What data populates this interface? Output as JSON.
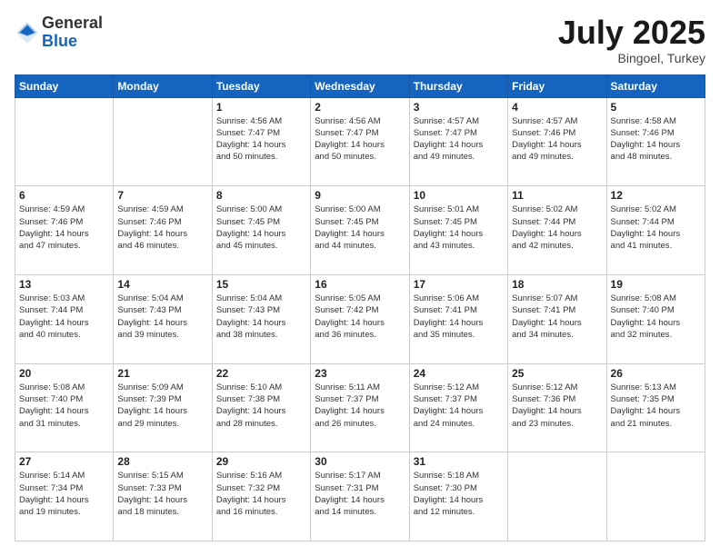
{
  "header": {
    "logo_line1": "General",
    "logo_line2": "Blue",
    "month": "July 2025",
    "location": "Bingoel, Turkey"
  },
  "days_of_week": [
    "Sunday",
    "Monday",
    "Tuesday",
    "Wednesday",
    "Thursday",
    "Friday",
    "Saturday"
  ],
  "weeks": [
    [
      {
        "day": "",
        "info": ""
      },
      {
        "day": "",
        "info": ""
      },
      {
        "day": "1",
        "info": "Sunrise: 4:56 AM\nSunset: 7:47 PM\nDaylight: 14 hours\nand 50 minutes."
      },
      {
        "day": "2",
        "info": "Sunrise: 4:56 AM\nSunset: 7:47 PM\nDaylight: 14 hours\nand 50 minutes."
      },
      {
        "day": "3",
        "info": "Sunrise: 4:57 AM\nSunset: 7:47 PM\nDaylight: 14 hours\nand 49 minutes."
      },
      {
        "day": "4",
        "info": "Sunrise: 4:57 AM\nSunset: 7:46 PM\nDaylight: 14 hours\nand 49 minutes."
      },
      {
        "day": "5",
        "info": "Sunrise: 4:58 AM\nSunset: 7:46 PM\nDaylight: 14 hours\nand 48 minutes."
      }
    ],
    [
      {
        "day": "6",
        "info": "Sunrise: 4:59 AM\nSunset: 7:46 PM\nDaylight: 14 hours\nand 47 minutes."
      },
      {
        "day": "7",
        "info": "Sunrise: 4:59 AM\nSunset: 7:46 PM\nDaylight: 14 hours\nand 46 minutes."
      },
      {
        "day": "8",
        "info": "Sunrise: 5:00 AM\nSunset: 7:45 PM\nDaylight: 14 hours\nand 45 minutes."
      },
      {
        "day": "9",
        "info": "Sunrise: 5:00 AM\nSunset: 7:45 PM\nDaylight: 14 hours\nand 44 minutes."
      },
      {
        "day": "10",
        "info": "Sunrise: 5:01 AM\nSunset: 7:45 PM\nDaylight: 14 hours\nand 43 minutes."
      },
      {
        "day": "11",
        "info": "Sunrise: 5:02 AM\nSunset: 7:44 PM\nDaylight: 14 hours\nand 42 minutes."
      },
      {
        "day": "12",
        "info": "Sunrise: 5:02 AM\nSunset: 7:44 PM\nDaylight: 14 hours\nand 41 minutes."
      }
    ],
    [
      {
        "day": "13",
        "info": "Sunrise: 5:03 AM\nSunset: 7:44 PM\nDaylight: 14 hours\nand 40 minutes."
      },
      {
        "day": "14",
        "info": "Sunrise: 5:04 AM\nSunset: 7:43 PM\nDaylight: 14 hours\nand 39 minutes."
      },
      {
        "day": "15",
        "info": "Sunrise: 5:04 AM\nSunset: 7:43 PM\nDaylight: 14 hours\nand 38 minutes."
      },
      {
        "day": "16",
        "info": "Sunrise: 5:05 AM\nSunset: 7:42 PM\nDaylight: 14 hours\nand 36 minutes."
      },
      {
        "day": "17",
        "info": "Sunrise: 5:06 AM\nSunset: 7:41 PM\nDaylight: 14 hours\nand 35 minutes."
      },
      {
        "day": "18",
        "info": "Sunrise: 5:07 AM\nSunset: 7:41 PM\nDaylight: 14 hours\nand 34 minutes."
      },
      {
        "day": "19",
        "info": "Sunrise: 5:08 AM\nSunset: 7:40 PM\nDaylight: 14 hours\nand 32 minutes."
      }
    ],
    [
      {
        "day": "20",
        "info": "Sunrise: 5:08 AM\nSunset: 7:40 PM\nDaylight: 14 hours\nand 31 minutes."
      },
      {
        "day": "21",
        "info": "Sunrise: 5:09 AM\nSunset: 7:39 PM\nDaylight: 14 hours\nand 29 minutes."
      },
      {
        "day": "22",
        "info": "Sunrise: 5:10 AM\nSunset: 7:38 PM\nDaylight: 14 hours\nand 28 minutes."
      },
      {
        "day": "23",
        "info": "Sunrise: 5:11 AM\nSunset: 7:37 PM\nDaylight: 14 hours\nand 26 minutes."
      },
      {
        "day": "24",
        "info": "Sunrise: 5:12 AM\nSunset: 7:37 PM\nDaylight: 14 hours\nand 24 minutes."
      },
      {
        "day": "25",
        "info": "Sunrise: 5:12 AM\nSunset: 7:36 PM\nDaylight: 14 hours\nand 23 minutes."
      },
      {
        "day": "26",
        "info": "Sunrise: 5:13 AM\nSunset: 7:35 PM\nDaylight: 14 hours\nand 21 minutes."
      }
    ],
    [
      {
        "day": "27",
        "info": "Sunrise: 5:14 AM\nSunset: 7:34 PM\nDaylight: 14 hours\nand 19 minutes."
      },
      {
        "day": "28",
        "info": "Sunrise: 5:15 AM\nSunset: 7:33 PM\nDaylight: 14 hours\nand 18 minutes."
      },
      {
        "day": "29",
        "info": "Sunrise: 5:16 AM\nSunset: 7:32 PM\nDaylight: 14 hours\nand 16 minutes."
      },
      {
        "day": "30",
        "info": "Sunrise: 5:17 AM\nSunset: 7:31 PM\nDaylight: 14 hours\nand 14 minutes."
      },
      {
        "day": "31",
        "info": "Sunrise: 5:18 AM\nSunset: 7:30 PM\nDaylight: 14 hours\nand 12 minutes."
      },
      {
        "day": "",
        "info": ""
      },
      {
        "day": "",
        "info": ""
      }
    ]
  ]
}
